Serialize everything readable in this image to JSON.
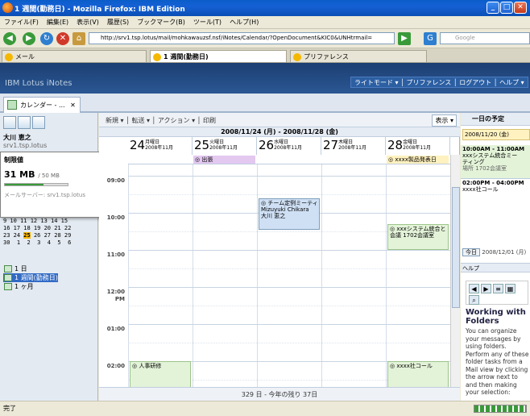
{
  "window": {
    "title": "1 週間(勤務日) - Mozilla Firefox: IBM Edition",
    "minimize": "_",
    "maximize": "□",
    "close": "✕"
  },
  "menu": [
    "ファイル(F)",
    "編集(E)",
    "表示(V)",
    "履歴(S)",
    "ブックマーク(B)",
    "ツール(T)",
    "ヘルプ(H)"
  ],
  "nav": {
    "url": "http://srv1.tsp.lotus/mail/mohkawauzsf.nsf/iNotes/Calendar/?OpenDocument&KIC0&UNHtrmail=",
    "search_placeholder": "Google"
  },
  "browser_tabs": [
    {
      "label": "メール",
      "active": false
    },
    {
      "label": "1 週間(勤務日)",
      "active": true
    },
    {
      "label": "プリファレンス",
      "active": false
    }
  ],
  "notes": {
    "brand": "IBM Lotus iNotes",
    "topnav": "ライトモード ▾ │ プリファレンス │ ログアウト │ ヘルプ ▾"
  },
  "apptab": {
    "label": "カレンダー - ...",
    "close": "✕"
  },
  "left": {
    "user_name": "大川 恵之",
    "user_server": "srv1.tsp.lotus",
    "quota_label": "制限値",
    "quota_size": "31 MB",
    "quota_max": "/ 50 MB",
    "quota_fraction": 0.62,
    "mail_server": "メールサーバー: srv1.tsp.lotus",
    "minical_lines": [
      "9 10 11 12 13 14 15",
      "16 17 18 19 20 21 22",
      "23 24 25 26 27 28 29",
      "30  1  2  3  4  5  6"
    ],
    "minical_today": "25",
    "views": [
      {
        "label": "1 日",
        "selected": false
      },
      {
        "label": "1 週間(勤務日)",
        "selected": true
      },
      {
        "label": "1 ヶ月",
        "selected": false
      }
    ]
  },
  "toolbar": {
    "items": "新規 ▾  │ 転送 ▾  │ アクション ▾  │ 印刷",
    "display": "表示 ▾"
  },
  "calendar": {
    "range": "2008/11/24 (月) - 2008/11/28 (金)",
    "days": [
      {
        "num": "24",
        "dow": "月曜日",
        "ym": "2008年11月"
      },
      {
        "num": "25",
        "dow": "火曜日",
        "ym": "2008年11月"
      },
      {
        "num": "26",
        "dow": "水曜日",
        "ym": "2008年11月"
      },
      {
        "num": "27",
        "dow": "木曜日",
        "ym": "2008年11月"
      },
      {
        "num": "28",
        "dow": "金曜日",
        "ym": "2008年11月"
      }
    ],
    "allday": [
      {
        "day": 1,
        "label": "◎ 出張",
        "color": "#e3c8f0"
      },
      {
        "day": 4,
        "label": "◎ xxxx製品発表日",
        "color": "#fff2c0"
      }
    ],
    "times": [
      "09:00",
      "10:00",
      "11:00",
      "12:00 PM",
      "01:00",
      "02:00"
    ],
    "events": [
      {
        "day": 2,
        "start": 0.6,
        "span": 0.85,
        "lines": [
          "◎ チーム定例ミーティ",
          "Mizuyuki Chikara",
          "大川 恵之"
        ],
        "color": "#cfe0f5",
        "border": "#7f9db9"
      },
      {
        "day": 4,
        "start": 1.3,
        "span": 0.7,
        "lines": [
          "◎ xxxシステム統合と",
          "会議 1702会議室"
        ],
        "color": "#e3f3d8",
        "border": "#9cc48a"
      },
      {
        "day": 0,
        "start": 5.0,
        "span": 0.9,
        "lines": [
          "◎ 人事研修"
        ],
        "color": "#e3f3d8",
        "border": "#9cc48a"
      },
      {
        "day": 4,
        "start": 5.0,
        "span": 0.9,
        "lines": [
          "◎ xxxx社コール"
        ],
        "color": "#e3f3d8",
        "border": "#9cc48a"
      }
    ],
    "footer": "329 日 - 今年の残り 37日"
  },
  "right": {
    "header": "一日の予定",
    "date_badge": "2008/11/20 (金)",
    "ev1": [
      "10:00AM - 11:00AM",
      "xxxシステム統合ミー",
      "ティング",
      "場所 1702会議室"
    ],
    "ev2": [
      "02:00PM - 04:00PM",
      "xxxx社コール"
    ],
    "today_btn": "今日",
    "today_date": "2008/12/01 (月)",
    "help_label": "ヘルプ",
    "help_title": "Working with Folders",
    "help_text": "You can organize your messages by using folders. Perform any of these folder tasks from a Mail view by clicking the arrow next to  and then making your selection:"
  },
  "status": {
    "text": "完了"
  }
}
